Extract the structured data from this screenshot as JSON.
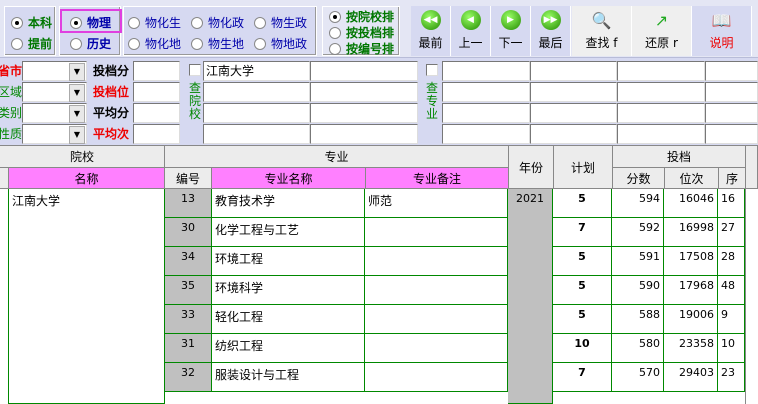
{
  "level": {
    "options": [
      "本科",
      "提前"
    ],
    "selected": "本科"
  },
  "first_subject": {
    "options": [
      "物理",
      "历史"
    ],
    "selected": "物理"
  },
  "combos": [
    "物化生",
    "物化政",
    "物生政",
    "物化地",
    "物生地",
    "物地政"
  ],
  "sort": {
    "options": [
      "按院校排",
      "按投档排",
      "按编号排"
    ],
    "selected": "按院校排"
  },
  "toolbar": {
    "first": "最前",
    "prev": "上一",
    "next": "下一",
    "last": "最后",
    "find": "查找 f",
    "restore": "还原 r",
    "help": "说明"
  },
  "filters": {
    "labels": [
      "省市",
      "区域",
      "类别",
      "性质"
    ],
    "num_labels": [
      "投档分",
      "投档位",
      "平均分",
      "平均次"
    ],
    "school_search_label": "查院校",
    "major_search_label": "查专业",
    "school_inputs": [
      "江南大学",
      "",
      "",
      "",
      "",
      "",
      "",
      ""
    ]
  },
  "table": {
    "group_headers": {
      "school": "院校",
      "major": "专业",
      "year": "年份",
      "plan": "计划",
      "admit": "投档"
    },
    "headers": {
      "name": "名称",
      "code": "编号",
      "major_name": "专业名称",
      "major_note": "专业备注",
      "score": "分数",
      "rank": "位次",
      "seq": "序"
    },
    "school": "江南大学",
    "year": "2021",
    "rows": [
      {
        "code": "13",
        "major": "教育技术学",
        "note": "师范",
        "plan": "5",
        "score": "594",
        "rank": "16046",
        "seq": "16"
      },
      {
        "code": "30",
        "major": "化学工程与工艺",
        "note": "",
        "plan": "7",
        "score": "592",
        "rank": "16998",
        "seq": "27"
      },
      {
        "code": "34",
        "major": "环境工程",
        "note": "",
        "plan": "5",
        "score": "591",
        "rank": "17508",
        "seq": "28"
      },
      {
        "code": "35",
        "major": "环境科学",
        "note": "",
        "plan": "5",
        "score": "590",
        "rank": "17968",
        "seq": "48"
      },
      {
        "code": "33",
        "major": "轻化工程",
        "note": "",
        "plan": "5",
        "score": "588",
        "rank": "19006",
        "seq": "9"
      },
      {
        "code": "31",
        "major": "纺织工程",
        "note": "",
        "plan": "10",
        "score": "580",
        "rank": "23358",
        "seq": "10"
      },
      {
        "code": "32",
        "major": "服装设计与工程",
        "note": "",
        "plan": "7",
        "score": "570",
        "rank": "29403",
        "seq": "23"
      }
    ]
  }
}
